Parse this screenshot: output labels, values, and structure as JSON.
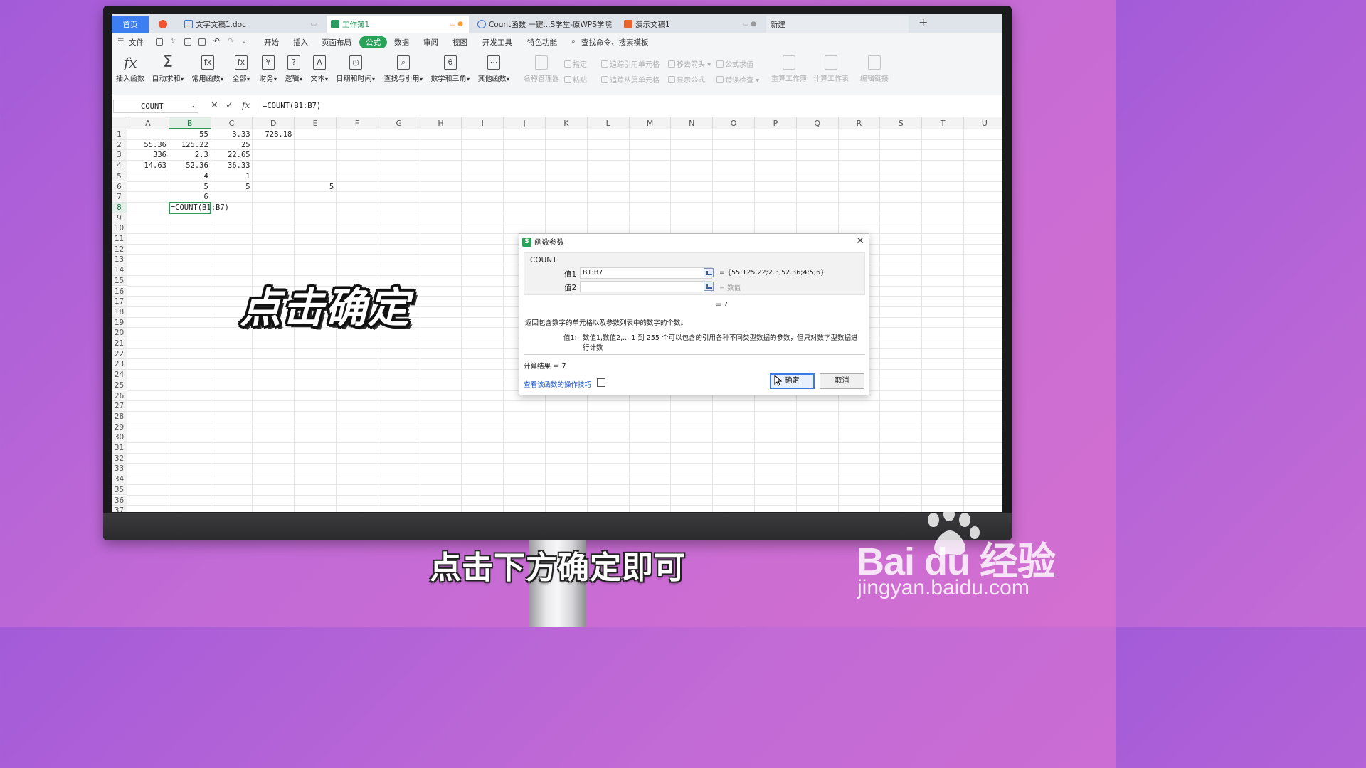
{
  "tabs": [
    {
      "label": "首页",
      "icon": "home"
    },
    {
      "label": "",
      "icon": "wps-logo-icon"
    },
    {
      "label": "文字文稿1.doc",
      "icon": "doc-icon"
    },
    {
      "label": "工作簿1",
      "icon": "sheet-icon"
    },
    {
      "label": "Count函数 一键...S学堂-原WPS学院",
      "icon": "web-icon"
    },
    {
      "label": "演示文稿1",
      "icon": "ppt-icon"
    },
    {
      "label": "新建",
      "icon": ""
    }
  ],
  "menu": {
    "file": "文件",
    "items": [
      "开始",
      "插入",
      "页面布局",
      "公式",
      "数据",
      "审阅",
      "视图",
      "开发工具",
      "特色功能"
    ],
    "active": "公式",
    "search": "查找命令、搜索模板"
  },
  "ribbon": {
    "buttons": [
      "插入函数",
      "自动求和",
      "常用函数",
      "全部",
      "财务",
      "逻辑",
      "文本",
      "日期和时间",
      "查找与引用",
      "数学和三角",
      "其他函数"
    ],
    "disabled_big": [
      "名称管理器",
      "重算工作簿",
      "计算工作表",
      "编辑链接"
    ],
    "disabled_small": [
      "指定",
      "粘贴",
      "追踪引用单元格",
      "追踪从属单元格",
      "移去箭头",
      "显示公式",
      "公式求值",
      "错误检查"
    ]
  },
  "formula_bar": {
    "name_box": "COUNT",
    "formula": "=COUNT(B1:B7)",
    "fx": "fx"
  },
  "grid": {
    "columns": [
      "A",
      "B",
      "C",
      "D",
      "E",
      "F",
      "G",
      "H",
      "I",
      "J",
      "K",
      "L",
      "M",
      "N",
      "O",
      "P",
      "Q",
      "R",
      "S",
      "T",
      "U"
    ],
    "selected_column": "B",
    "rows": 37,
    "selected_row": 8,
    "cells": [
      {
        "ref": "B1",
        "v": "55"
      },
      {
        "ref": "C1",
        "v": "3.33"
      },
      {
        "ref": "D1",
        "v": "728.18"
      },
      {
        "ref": "A2",
        "v": "55.36"
      },
      {
        "ref": "B2",
        "v": "125.22"
      },
      {
        "ref": "C2",
        "v": "25"
      },
      {
        "ref": "A3",
        "v": "336"
      },
      {
        "ref": "B3",
        "v": "2.3"
      },
      {
        "ref": "C3",
        "v": "22.65"
      },
      {
        "ref": "A4",
        "v": "14.63"
      },
      {
        "ref": "B4",
        "v": "52.36"
      },
      {
        "ref": "C4",
        "v": "36.33"
      },
      {
        "ref": "B5",
        "v": "4"
      },
      {
        "ref": "C5",
        "v": "1"
      },
      {
        "ref": "B6",
        "v": "5"
      },
      {
        "ref": "C6",
        "v": "5"
      },
      {
        "ref": "E6",
        "v": "5"
      },
      {
        "ref": "B7",
        "v": "6"
      },
      {
        "ref": "B8",
        "v": "=COUNT(B1:B7)",
        "left": true
      }
    ]
  },
  "caption_on_screen": "点击确定",
  "dialog": {
    "title": "函数参数",
    "function_name": "COUNT",
    "arg1_label": "值1",
    "arg1_value": "B1:B7",
    "arg1_result": "= {55;125.22;2.3;52.36;4;5;6}",
    "arg2_label": "值2",
    "arg2_value": "",
    "arg2_result": "= 数值",
    "result_mid": "= 7",
    "description": "返回包含数字的单元格以及参数列表中的数字的个数。",
    "param_label": "值1:",
    "param_desc_1": "数值1,数值2,... 1 到 255 个可以包含的引用各种不同类型数据的参数，但只对数字型数据进",
    "param_desc_2": "行计数",
    "calc_result": "计算结果 ＝ 7",
    "help_link": "查看该函数的操作技巧",
    "ok": "确定",
    "cancel": "取消"
  },
  "subtitle": "点击下方确定即可",
  "watermark": {
    "brand": "Bai  du 经验",
    "url": "jingyan.baidu.com"
  }
}
